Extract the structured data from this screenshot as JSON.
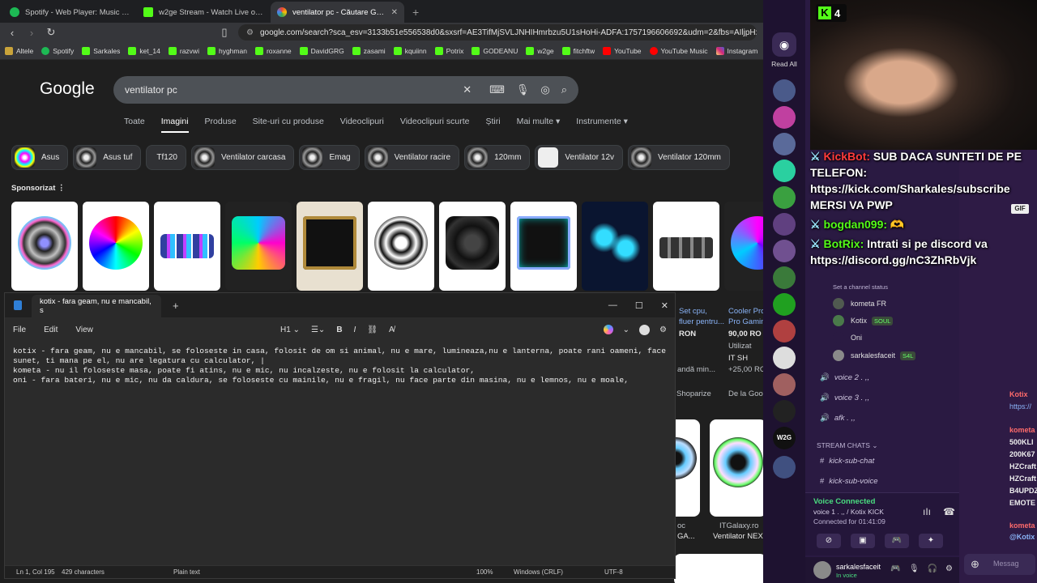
{
  "browser": {
    "tabs": [
      {
        "title": "Spotify - Web Player: Music for everyone",
        "color": "#1db954"
      },
      {
        "title": "w2ge Stream - Watch Live on Kick",
        "color": "#53fc18"
      },
      {
        "title": "ventilator pc - Căutare Google",
        "color": "#4285f4"
      }
    ],
    "url": "google.com/search?sca_esv=3133b51e556538d0&sxsrf=AE3TifMjSVLJNHIHmrbzu5U1sHoHi-ADFA:1757196606692&udm=2&fbs=AIljpHxX5k-tONt...",
    "bookmarks": [
      "Altele",
      "Spotify",
      "Sarkales",
      "ket_14",
      "razvwi",
      "hyghman",
      "roxanne",
      "DavidGRG",
      "zasami",
      "kquiinn",
      "Potrix",
      "GODEANU",
      "w2ge",
      "fitchftw",
      "YouTube",
      "YouTube Music",
      "Instagram"
    ]
  },
  "google": {
    "logo": "Google",
    "query": "ventilator pc",
    "tabs": [
      "Toate",
      "Imagini",
      "Produse",
      "Site-uri cu produse",
      "Videoclipuri",
      "Videoclipuri scurte",
      "Știri",
      "Mai multe ▾",
      "Instrumente ▾"
    ],
    "active_tab": "Imagini",
    "chips": [
      "Asus",
      "Asus tuf",
      "Tf120",
      "Ventilator carcasa",
      "Emag",
      "Ventilator racire",
      "120mm",
      "Ventilator 12v",
      "Ventilator 120mm"
    ],
    "sponsored": "Sponsorizat",
    "partial_results": {
      "r1_line1": "Set cpu,",
      "r1_line2": "fluer pentru...",
      "r1_price": "RON",
      "r1_shop": "Shoparize",
      "r2_line1": "Cooler Pro",
      "r2_line2": "Pro Gamin",
      "r2_price": "90,00 RO",
      "r2_used": "Utilizat",
      "r2_shop": "IT SH",
      "r2_ship": "+25,00 RO",
      "r2_shop2": "De la Goo",
      "r1_extra": "andă min...",
      "lower_shop1": "oc",
      "lower_shop1_b": "GA...",
      "lower_shop2": "ITGalaxy.ro",
      "lower_shop2_b": "Ventilator NEX"
    }
  },
  "notepad": {
    "tab_title": "kotix - fara geam, nu e mancabil, s",
    "menu": [
      "File",
      "Edit",
      "View"
    ],
    "heading": "H1",
    "lines": [
      "kotix - fara geam, nu e mancabil, se foloseste in casa, folosit de om si animal, nu e mare, lumineaza,nu e lanterna, poate rani oameni, face sunet, ti mana pe el, nu are legatura cu calculator, |",
      "kometa - nu il foloseste masa, poate fi atins, nu e mic, nu incalzeste, nu e folosit la calculator,",
      "oni - fara bateri, nu e mic, nu da caldura, se foloseste cu mainile, nu e fragil, nu face parte din masina, nu e lemnos, nu e moale,"
    ],
    "status": {
      "position": "Ln 1, Col 195",
      "chars": "429 characters",
      "format": "Plain text",
      "zoom": "100%",
      "eol": "Windows (CRLF)",
      "encoding": "UTF-8"
    }
  },
  "discord": {
    "read_all": "Read All",
    "channel_status": "Set a channel status",
    "voice_users": [
      {
        "name": "kometa FR",
        "badge": ""
      },
      {
        "name": "Kotix",
        "badge": "SOUL"
      },
      {
        "name": "Oni",
        "badge": ""
      },
      {
        "name": "sarkalesfaceit",
        "badge": "S4L"
      }
    ],
    "voice_channels": [
      "voice 2 . ,,",
      "voice 3 . ,,",
      "afk . ,,"
    ],
    "stream_chats": "STREAM CHATS",
    "text_channels": [
      "kick-sub-chat",
      "kick-sub-voice"
    ],
    "voice_connected": "Voice Connected",
    "voice_channel": "voice 1 . ,, / Kotix KICK",
    "connected_for": "Connected for 01:41:09",
    "user": {
      "name": "sarkalesfaceit",
      "status": "In voice"
    },
    "message_placeholder": "Messag"
  },
  "stream": {
    "kick_count": "4",
    "chat": [
      {
        "nick": "KickBot:",
        "text": "SUB DACA SUNTETI DE PE TELEFON: https://kick.com/Sharkales/subscribe MERSI VA PWP",
        "color": "#ff3b3b"
      },
      {
        "nick": "bogdan099:",
        "text": "🫶",
        "color": "#53fc18"
      },
      {
        "nick": "BotRix:",
        "text": "Intrati si pe discord va https://discord.gg/nC3ZhRbVjk",
        "color": "#53fc18"
      }
    ],
    "gif": "GIF",
    "right_chat": [
      "Kotix",
      "https://",
      "kometa",
      "500KLI",
      "200K67",
      "HZCraft",
      "HZCraft",
      "B4UPDZ",
      "EMOTE",
      "kometa",
      "@Kotix"
    ]
  }
}
